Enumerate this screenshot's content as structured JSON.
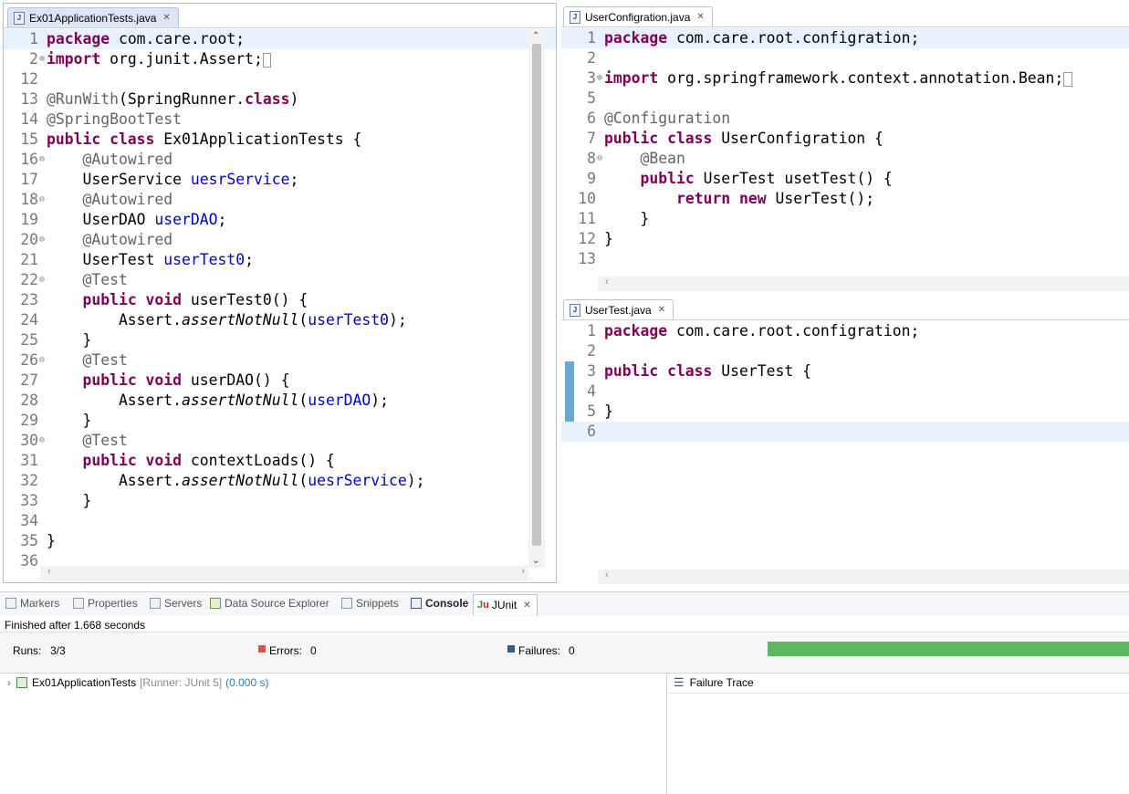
{
  "colors": {
    "keyword": "#7f0055",
    "annotation": "#646464",
    "field": "#0000c0",
    "progress": "#5cb85c",
    "current_line": "#e8f2fe"
  },
  "left_editor": {
    "tab": "Ex01ApplicationTests.java",
    "lines": [
      {
        "n": "1",
        "html": "<span class='kw'>package</span> com.care.root;"
      },
      {
        "n": "2",
        "fold": "plus",
        "html": "<span class='kw'>import</span> org.junit.Assert;<span style='border:1px solid #999;font-size:12px'>&nbsp;</span>"
      },
      {
        "n": "12",
        "html": ""
      },
      {
        "n": "13",
        "html": "<span class='an'>@RunWith</span>(SpringRunner.<span class='kw'>class</span>)"
      },
      {
        "n": "14",
        "html": "<span class='an'>@SpringBootTest</span>"
      },
      {
        "n": "15",
        "html": "<span class='kw'>public class</span> Ex01ApplicationTests {"
      },
      {
        "n": "16",
        "fold": "minus",
        "html": "    <span class='an'>@Autowired</span>"
      },
      {
        "n": "17",
        "html": "    UserService <span class='fld'>uesrService</span>;"
      },
      {
        "n": "18",
        "fold": "minus",
        "html": "    <span class='an'>@Autowired</span>"
      },
      {
        "n": "19",
        "html": "    UserDAO <span class='fld'>userDAO</span>;"
      },
      {
        "n": "20",
        "fold": "minus",
        "html": "    <span class='an'>@Autowired</span>"
      },
      {
        "n": "21",
        "html": "    UserTest <span class='fld'>userTest0</span>;"
      },
      {
        "n": "22",
        "fold": "minus",
        "html": "    <span class='an'>@Test</span>"
      },
      {
        "n": "23",
        "html": "    <span class='kw'>public void</span> userTest0() {"
      },
      {
        "n": "24",
        "html": "        Assert.<span class='it'>assertNotNull</span>(<span class='fld'>userTest0</span>);"
      },
      {
        "n": "25",
        "html": "    }"
      },
      {
        "n": "26",
        "fold": "minus",
        "html": "    <span class='an'>@Test</span>"
      },
      {
        "n": "27",
        "html": "    <span class='kw'>public void</span> userDAO() {"
      },
      {
        "n": "28",
        "html": "        Assert.<span class='it'>assertNotNull</span>(<span class='fld'>userDAO</span>);"
      },
      {
        "n": "29",
        "html": "    }"
      },
      {
        "n": "30",
        "fold": "minus",
        "html": "    <span class='an'>@Test</span>"
      },
      {
        "n": "31",
        "html": "    <span class='kw'>public void</span> contextLoads() {"
      },
      {
        "n": "32",
        "html": "        Assert.<span class='it'>assertNotNull</span>(<span class='fld'>uesrService</span>);"
      },
      {
        "n": "33",
        "html": "    }"
      },
      {
        "n": "34",
        "html": ""
      },
      {
        "n": "35",
        "html": "}"
      },
      {
        "n": "36",
        "html": ""
      }
    ]
  },
  "right_top_editor": {
    "tab": "UserConfigration.java",
    "lines": [
      {
        "n": "1",
        "html": "<span class='kw'>package</span> com.care.root.configration;"
      },
      {
        "n": "2",
        "html": ""
      },
      {
        "n": "3",
        "fold": "plus",
        "html": "<span class='kw'>import</span> org.springframework.context.annotation.Bean;<span style='border:1px solid #999;font-size:12px'>&nbsp;</span>"
      },
      {
        "n": "5",
        "html": ""
      },
      {
        "n": "6",
        "html": "<span class='an'>@Configuration</span>"
      },
      {
        "n": "7",
        "html": "<span class='kw'>public class</span> UserConfigration {"
      },
      {
        "n": "8",
        "fold": "minus",
        "html": "    <span class='an'>@Bean</span>"
      },
      {
        "n": "9",
        "html": "    <span class='kw'>public</span> UserTest usetTest() {"
      },
      {
        "n": "10",
        "html": "        <span class='kw'>return new</span> UserTest();"
      },
      {
        "n": "11",
        "html": "    }"
      },
      {
        "n": "12",
        "html": "}"
      },
      {
        "n": "13",
        "html": ""
      }
    ]
  },
  "right_bottom_editor": {
    "tab": "UserTest.java",
    "lines": [
      {
        "n": "1",
        "html": "<span class='kw'>package</span> com.care.root.configration;"
      },
      {
        "n": "2",
        "html": ""
      },
      {
        "n": "3",
        "html": "<span class='kw'>public class</span> UserTest {"
      },
      {
        "n": "4",
        "html": ""
      },
      {
        "n": "5",
        "html": "}"
      },
      {
        "n": "6",
        "html": ""
      }
    ]
  },
  "bottom_panel": {
    "tabs": [
      "Markers",
      "Properties",
      "Servers",
      "Data Source Explorer",
      "Snippets",
      "Console",
      "JUnit"
    ],
    "finished": "Finished after 1.668 seconds",
    "runs_label": "Runs:",
    "runs_value": "3/3",
    "errors_label": "Errors:",
    "errors_value": "0",
    "failures_label": "Failures:",
    "failures_value": "0",
    "progress": 1.0,
    "tree_item": "Ex01ApplicationTests",
    "tree_runner": "[Runner: JUnit 5]",
    "tree_time": "(0.000 s)",
    "failure_trace": "Failure Trace"
  }
}
